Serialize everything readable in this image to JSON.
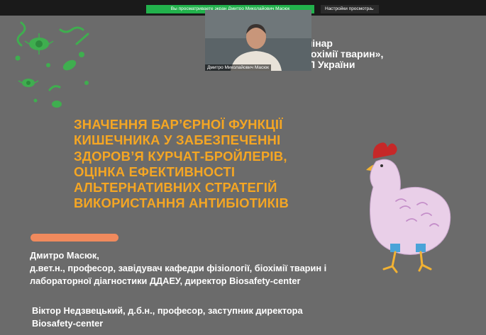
{
  "toolbar": {
    "share_status": "Вы просматриваете экран Дмитро Миколайович Масюк",
    "view_options": "Настройки просмотра",
    "view_options_icon": "chevron-down-icon"
  },
  "video": {
    "participant_name": "Дмитро Миколайович Масюк"
  },
  "slide": {
    "header_lines": [
      "Н                      ний семінар",
      "«Актуальні                 огії та біохімії тварин»,",
      "присв               ю НУБіП України"
    ],
    "title_lines": [
      "ЗНАЧЕННЯ БАР’ЄРНОЇ ФУНКЦІЇ",
      "КИШЕЧНИКА У ЗАБЕЗПЕЧЕННІ",
      "ЗДОРОВ’Я КУРЧАТ-БРОЙЛЕРІВ,",
      "ОЦІНКА ЕФЕКТИВНОСТІ",
      "АЛЬТЕРНАТИВНИХ СТРАТЕГІЙ",
      "ВИКОРИСТАННЯ АНТИБІОТИКІВ"
    ],
    "author1_lines": [
      "Дмитро Масюк,",
      "д.вет.н., професор, завідувач кафедри фізіології, біохімії тварин і",
      "лабораторної діагностики ДДАЕУ, директор Biosafety-center"
    ],
    "author2_lines": [
      "Віктор Недзвецький, д.б.н., професор, заступник директора",
      "Biosafety-center"
    ],
    "colors": {
      "background": "#6b6b6b",
      "title": "#f5a623",
      "accent_bar": "#f08a5d",
      "microbes": "#3fae4f",
      "chicken_body": "#e9cfe8"
    }
  }
}
